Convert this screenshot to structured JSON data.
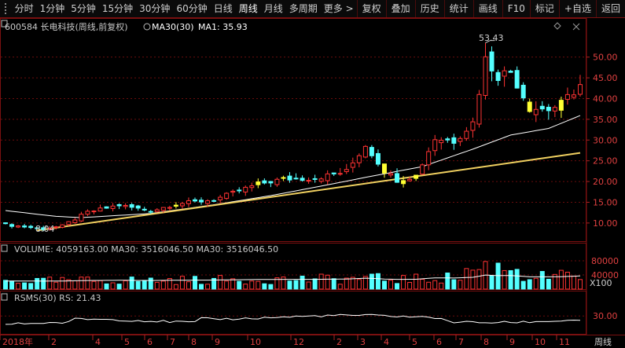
{
  "toolbar": {
    "periods": [
      "分时",
      "1分钟",
      "5分钟",
      "15分钟",
      "30分钟",
      "60分钟",
      "日线",
      "周线",
      "月线",
      "多周期",
      "更多"
    ],
    "active_period": "周线",
    "more_arrow": ">",
    "actions": [
      "复权",
      "叠加",
      "历史",
      "统计",
      "画线",
      "F10",
      "标记",
      "+自选",
      "返回"
    ]
  },
  "main_panel": {
    "header": "600584 长电科技(周线,前复权)",
    "ma_legend": [
      "MA30(30)",
      "MA1: 35.93"
    ],
    "top_right_icons": [
      "diamond-icon",
      "close-icon"
    ],
    "high_label": "53.43",
    "low_label": "8.04",
    "y_ticks": [
      "50.00",
      "45.00",
      "40.00",
      "35.00",
      "30.00",
      "25.00",
      "20.00",
      "15.00",
      "10.00"
    ]
  },
  "volume_panel": {
    "header": "VOLUME: 4059163.00  MA30: 3516046.50  MA30: 3516046.50",
    "y_ticks": [
      "80000",
      "40000"
    ],
    "unit": "X100"
  },
  "rsms_panel": {
    "header": "RSMS(30)  RS: 21.43",
    "y_ticks": [
      "30.00"
    ]
  },
  "x_axis": {
    "labels": [
      "2018年",
      "2",
      "4",
      "5",
      "6",
      "7",
      "8",
      "9",
      "10",
      "12",
      "2",
      "3",
      "4",
      "5",
      "6",
      "7",
      "8",
      "9",
      "10",
      "11"
    ],
    "period_label": "周线"
  },
  "colors": {
    "background": "#000000",
    "grid": "#6a0c0c",
    "up": "#ff3333",
    "down": "#54ffff",
    "ma": "#ffffff",
    "trendline": "#f0d060",
    "highlight_bar": "#ffff33"
  },
  "chart_data": {
    "type": "candlestick",
    "ylim": [
      6,
      56
    ],
    "weeks": 92,
    "price_keypoints": [
      [
        0,
        9.6
      ],
      [
        6,
        8.6
      ],
      [
        9,
        9.3
      ],
      [
        13,
        12.6
      ],
      [
        18,
        14.3
      ],
      [
        23,
        12.9
      ],
      [
        27,
        14.6
      ],
      [
        33,
        15.6
      ],
      [
        40,
        19.4
      ],
      [
        44,
        20.6
      ],
      [
        49,
        20.8
      ],
      [
        54,
        22.4
      ],
      [
        57,
        28.8
      ],
      [
        60,
        22.6
      ],
      [
        62,
        20.4
      ],
      [
        65,
        21.4
      ],
      [
        68,
        30.4
      ],
      [
        71,
        29.8
      ],
      [
        74,
        34.2
      ],
      [
        76,
        49.5
      ],
      [
        78,
        45.6
      ],
      [
        80,
        46.5
      ],
      [
        83,
        37.8
      ],
      [
        86,
        37.4
      ],
      [
        88,
        38.6
      ],
      [
        90,
        41.8
      ],
      [
        91,
        43.3
      ]
    ],
    "ma30_keypoints": [
      [
        0,
        13.0
      ],
      [
        8,
        11.6
      ],
      [
        12,
        11.3
      ],
      [
        23,
        12.3
      ],
      [
        33,
        14.4
      ],
      [
        42,
        16.6
      ],
      [
        50,
        18.9
      ],
      [
        58,
        21.3
      ],
      [
        66,
        23.6
      ],
      [
        74,
        27.8
      ],
      [
        80,
        31.2
      ],
      [
        86,
        32.8
      ],
      [
        91,
        35.9
      ]
    ],
    "trendline": [
      [
        5,
        8.2
      ],
      [
        91,
        26.9
      ]
    ],
    "volume_range": [
      0,
      100000
    ],
    "rsms_range": [
      0,
      50
    ]
  }
}
